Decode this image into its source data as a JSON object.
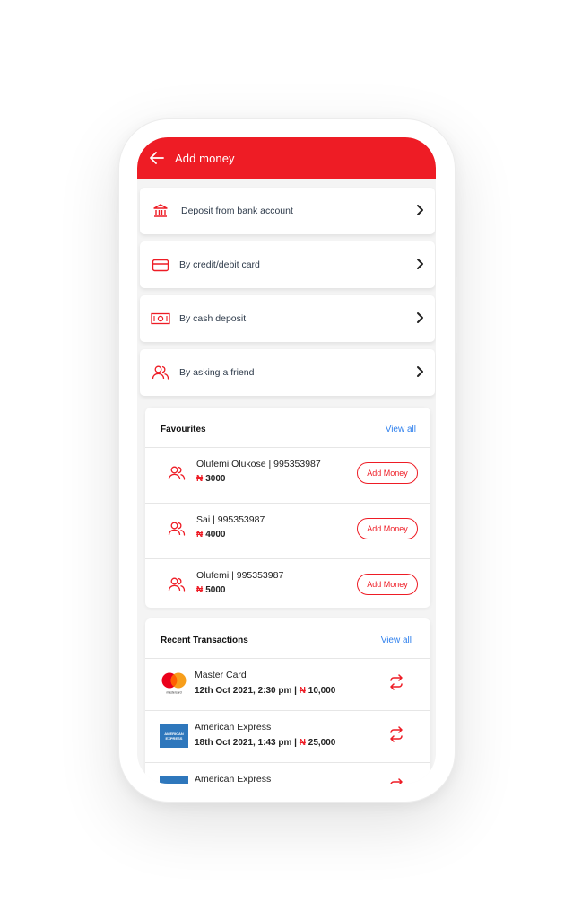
{
  "header": {
    "title": "Add money"
  },
  "options": [
    {
      "label": "Deposit from bank account",
      "icon": "bank-icon"
    },
    {
      "label": "By credit/debit card",
      "icon": "card-icon"
    },
    {
      "label": "By cash deposit",
      "icon": "cash-icon"
    },
    {
      "label": "By asking a friend",
      "icon": "friends-icon"
    }
  ],
  "favourites": {
    "title": "Favourites",
    "view_all": "View all",
    "items": [
      {
        "name": "Olufemi Olukose | 995353987",
        "currency": "₦",
        "amount": "3000",
        "button": "Add Money"
      },
      {
        "name": "Sai | 995353987",
        "currency": "₦",
        "amount": "4000",
        "button": "Add Money"
      },
      {
        "name": "Olufemi | 995353987",
        "currency": "₦",
        "amount": "5000",
        "button": "Add Money"
      }
    ]
  },
  "recent": {
    "title": "Recent Transactions",
    "view_all": "View all",
    "items": [
      {
        "card": "Master Card",
        "logo_text": "mastercard",
        "date": "12th Oct 2021, 2:30 pm | ",
        "currency": "₦",
        "amount": " 10,000"
      },
      {
        "card": "American Express",
        "logo_text": "AMERICAN EXPRESS",
        "date": "18th Oct 2021, 1:43 pm | ",
        "currency": "₦",
        "amount": " 25,000"
      },
      {
        "card": "American Express"
      }
    ]
  },
  "colors": {
    "brand_red": "#ee1c25",
    "link_blue": "#2f80ed",
    "amex_blue": "#2e77bc"
  }
}
